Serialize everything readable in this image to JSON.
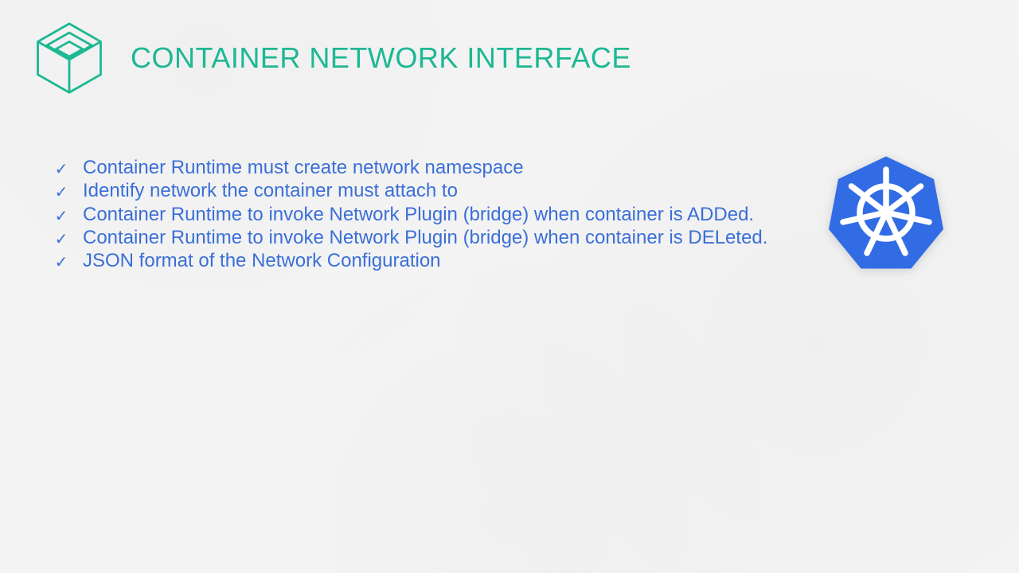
{
  "title": "CONTAINER NETWORK INTERFACE",
  "colors": {
    "accent_teal": "#1db894",
    "text_blue": "#3a6fd8",
    "k8s_blue": "#326ce5",
    "background": "#f4f4f4"
  },
  "icons": {
    "header_logo": "cni-cube-logo",
    "side_logo": "kubernetes-wheel-logo",
    "bullet_marker": "checkmark"
  },
  "bullets": [
    "Container Runtime must create network namespace",
    "Identify network the container must attach to",
    "Container Runtime to invoke Network Plugin (bridge) when container is ADDed.",
    "Container Runtime to invoke Network Plugin (bridge) when container is DELeted.",
    "JSON format of the Network Configuration"
  ]
}
